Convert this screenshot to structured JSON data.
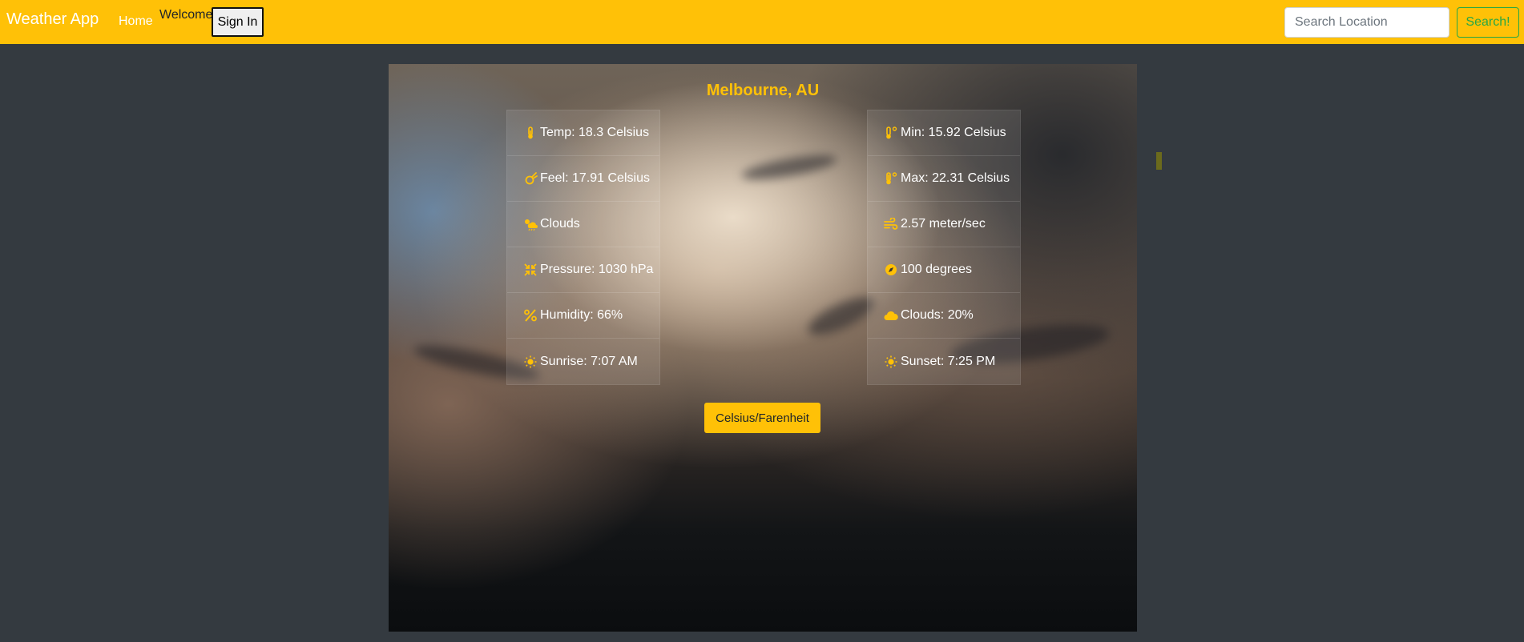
{
  "navbar": {
    "brand": "Weather App",
    "home": "Home",
    "welcome": "Welcome",
    "signin": "Sign In",
    "search_placeholder": "Search Location",
    "search_button": "Search!"
  },
  "weather": {
    "city": "Melbourne, AU",
    "left": [
      {
        "icon": "thermometer-icon",
        "text": "Temp: 18.3 Celsius"
      },
      {
        "icon": "comet-icon",
        "text": "Feel: 17.91 Celsius"
      },
      {
        "icon": "cloud-sun-rain-icon",
        "text": "Clouds"
      },
      {
        "icon": "compress-arrows-icon",
        "text": "Pressure: 1030 hPa"
      },
      {
        "icon": "percent-icon",
        "text": "Humidity: 66%"
      },
      {
        "icon": "sun-icon",
        "text": "Sunrise: 7:07 AM"
      }
    ],
    "right": [
      {
        "icon": "temperature-low-icon",
        "text": "Min: 15.92 Celsius"
      },
      {
        "icon": "temperature-high-icon",
        "text": "Max: 22.31 Celsius"
      },
      {
        "icon": "wind-icon",
        "text": "2.57 meter/sec"
      },
      {
        "icon": "compass-icon",
        "text": "100 degrees"
      },
      {
        "icon": "cloud-icon",
        "text": "Clouds: 20%"
      },
      {
        "icon": "sun-icon",
        "text": "Sunset: 7:25 PM"
      }
    ],
    "unit_toggle": "Celsius/Farenheit"
  },
  "colors": {
    "navbar": "#ffc107",
    "accent": "#ffc107",
    "page_bg": "#343a40",
    "search_button": "#28a745"
  }
}
